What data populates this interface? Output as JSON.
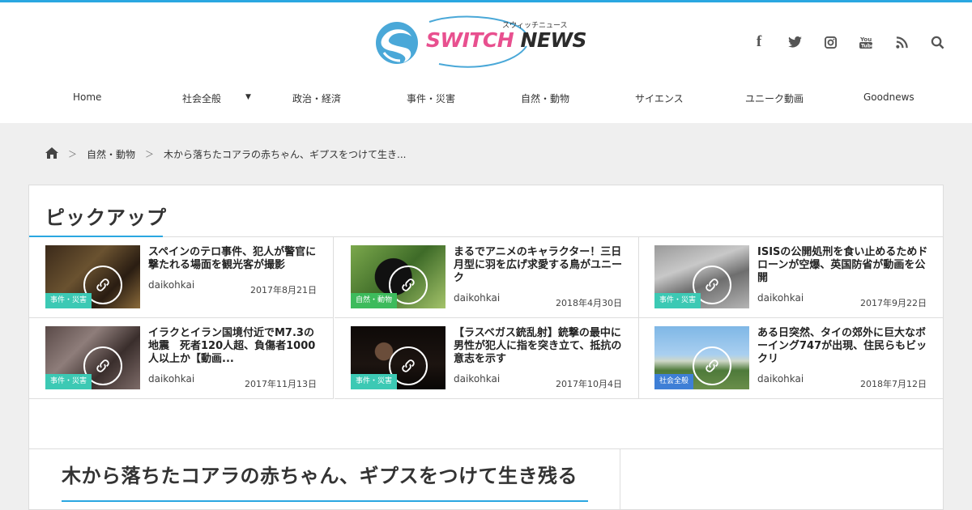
{
  "site": {
    "logo_kana": "スウィッチニュース",
    "logo_switch": "SWITCH",
    "logo_news": "NEWS"
  },
  "social_icons": [
    "facebook-icon",
    "twitter-icon",
    "instagram-icon",
    "youtube-icon",
    "rss-icon",
    "search-icon"
  ],
  "nav": {
    "items": [
      "Home",
      "社会全般",
      "政治・経済",
      "事件・災害",
      "自然・動物",
      "サイエンス",
      "ユニーク動画",
      "Goodnews"
    ]
  },
  "breadcrumb": {
    "home_icon": "home-icon",
    "category": "自然・動物",
    "current": "木から落ちたコアラの赤ちゃん、ギプスをつけて生き..."
  },
  "pickup": {
    "title": "ピックアップ",
    "cards": [
      {
        "title": "スペインのテロ事件、犯人が警官に撃たれる場面を観光客が撮影",
        "author": "daikohkai",
        "date": "2017年8月21日",
        "category": "事件・災害"
      },
      {
        "title": "まるでアニメのキャラクター！三日月型に羽を広げ求愛する鳥がユニーク",
        "author": "daikohkai",
        "date": "2018年4月30日",
        "category": "自然・動物"
      },
      {
        "title": "ISISの公開処刑を食い止めるためドローンが空爆、英国防省が動画を公開",
        "author": "daikohkai",
        "date": "2017年9月22日",
        "category": "事件・災害"
      },
      {
        "title": "イラクとイラン国境付近でM7.3の地震　死者120人超、負傷者1000人以上か【動画...",
        "author": "daikohkai",
        "date": "2017年11月13日",
        "category": "事件・災害"
      },
      {
        "title": "【ラスベガス銃乱射】銃撃の最中に男性が犯人に指を突き立て、抵抗の意志を示す",
        "author": "daikohkai",
        "date": "2017年10月4日",
        "category": "事件・災害"
      },
      {
        "title": "ある日突然、タイの郊外に巨大なボーイング747が出現、住民らもビックリ",
        "author": "daikohkai",
        "date": "2018年7月12日",
        "category": "社会全般"
      }
    ]
  },
  "article": {
    "title": "木から落ちたコアラの赤ちゃん、ギプスをつけて生き残る"
  },
  "colors": {
    "accent": "#2aa7e1",
    "cat_teal": "#3cc9b4",
    "cat_green": "#3dbb5c",
    "cat_blue": "#3e7fd6",
    "logo_pink": "#e8508f"
  }
}
